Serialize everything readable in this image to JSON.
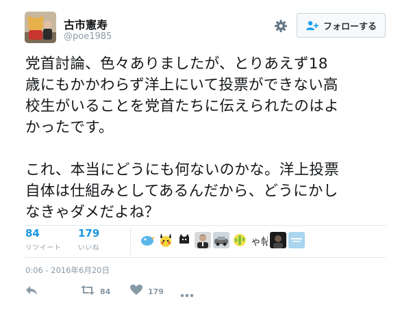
{
  "user": {
    "display_name": "古市憲寿",
    "handle": "@poe1985"
  },
  "follow_button": {
    "label": "フォローする"
  },
  "tweet": {
    "text": "党首討論、色々ありましたが、とりあえず18\n歳にもかかわらず洋上にいて投票ができない高\n校生がいることを党首たちに伝えられたのはよ\nかったです。\n\nこれ、本当にどうにも何ないのかな。洋上投票\n自体は仕組みとしてあるんだから、どうにかし\nなきゃダメだよね？"
  },
  "stats": {
    "retweets": {
      "count": "84",
      "label": "リツイート"
    },
    "likes": {
      "count": "179",
      "label": "いいね"
    }
  },
  "likers": [
    {
      "name": "twitter-bird",
      "color": "#5bb7ea"
    },
    {
      "name": "pikachu",
      "color": "#f5d33a"
    },
    {
      "name": "black-cat",
      "color": "#1f1f1f"
    },
    {
      "name": "man-portrait",
      "color": "#3a3a3a"
    },
    {
      "name": "car-photo",
      "color": "#8e8e8e"
    },
    {
      "name": "cactus-emoji",
      "color": "#7ec242"
    },
    {
      "name": "handwriting",
      "color": "#333333"
    },
    {
      "name": "dark-portrait",
      "color": "#2a2a2a"
    },
    {
      "name": "light-blue-logo",
      "color": "#a9d5ef"
    }
  ],
  "likers_text": {
    "handwriting": "ゃ帖"
  },
  "timestamp": "0:06 - 2016年6月20日",
  "actions": {
    "reply": {
      "icon": "reply-icon"
    },
    "retweet": {
      "icon": "retweet-icon",
      "count": "84"
    },
    "like": {
      "icon": "heart-icon",
      "count": "179"
    },
    "more": {
      "icon": "more-icon"
    }
  },
  "colors": {
    "accent": "#1b95e0",
    "muted": "#8899a6",
    "text": "#14171a",
    "border": "#e1e8ed"
  }
}
